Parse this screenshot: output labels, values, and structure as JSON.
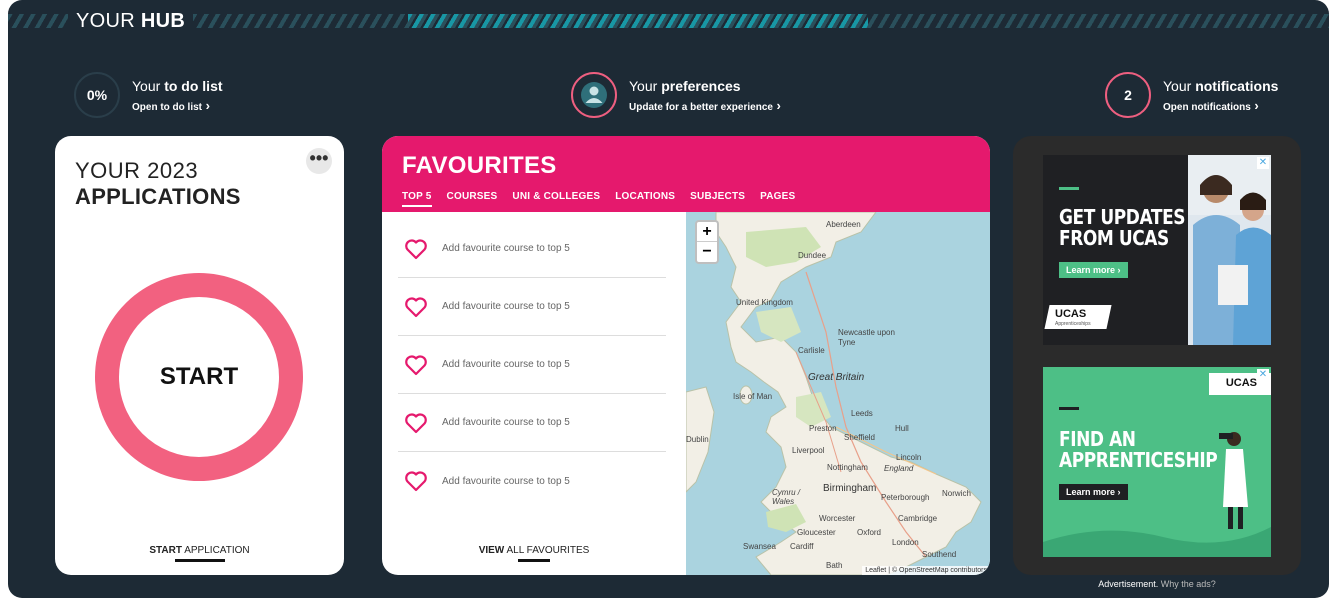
{
  "hub": {
    "title_prefix": "YOUR",
    "title_bold": "HUB"
  },
  "links": {
    "todo": {
      "circle": "0%",
      "prefix": "Your",
      "bold": "to do list",
      "sub": "Open to do list"
    },
    "prefs": {
      "prefix": "Your",
      "bold": "preferences",
      "sub": "Update for a better experience",
      "icon": "person-icon"
    },
    "notifications": {
      "circle": "2",
      "prefix": "Your",
      "bold": "notifications",
      "sub": "Open notifications"
    }
  },
  "applications": {
    "line1": "YOUR 2023",
    "line2": "APPLICATIONS",
    "menu": "•••",
    "ring_label": "START",
    "link_bold": "START",
    "link_rest": "APPLICATION"
  },
  "favourites": {
    "title": "FAVOURITES",
    "tabs": [
      "TOP 5",
      "COURSES",
      "UNI & COLLEGES",
      "LOCATIONS",
      "SUBJECTS",
      "PAGES"
    ],
    "items": [
      "Add favourite course to top 5",
      "Add favourite course to top 5",
      "Add favourite course to top 5",
      "Add favourite course to top 5",
      "Add favourite course to top 5"
    ],
    "view_bold": "VIEW",
    "view_rest": "ALL FAVOURITES"
  },
  "map": {
    "zoom_in": "+",
    "zoom_out": "−",
    "labels": [
      "Aberdeen",
      "Dundee",
      "United Kingdom",
      "Newcastle upon Tyne",
      "Carlisle",
      "Great Britain",
      "Isle of Man",
      "Leeds",
      "Preston",
      "Hull",
      "Sheffield",
      "Dublin",
      "Liverpool",
      "Lincoln",
      "Nottingham",
      "England",
      "Birmingham",
      "Peterborough",
      "Norwich",
      "Cymru / Wales",
      "Worcester",
      "Cambridge",
      "Gloucester",
      "Oxford",
      "Swansea",
      "Cardiff",
      "London",
      "Southend",
      "Bath"
    ],
    "attribution": "Leaflet | © OpenStreetMap contributors"
  },
  "ads": {
    "ad1": {
      "headline1": "GET UPDATES",
      "headline2": "FROM UCAS",
      "button": "Learn more ›",
      "logo": "UCAS",
      "logo_sub": "Apprenticeships"
    },
    "ad2": {
      "logo": "UCAS",
      "headline1": "FIND AN",
      "headline2": "APPRENTICESHIP",
      "button": "Learn more ›"
    },
    "close": "✕",
    "note": "Advertisement.",
    "why": "Why the ads?"
  },
  "colors": {
    "pink": "#e5196d",
    "ring": "#f26180",
    "hub_bg": "#1d2a35",
    "ad_green": "#4dbf86"
  }
}
